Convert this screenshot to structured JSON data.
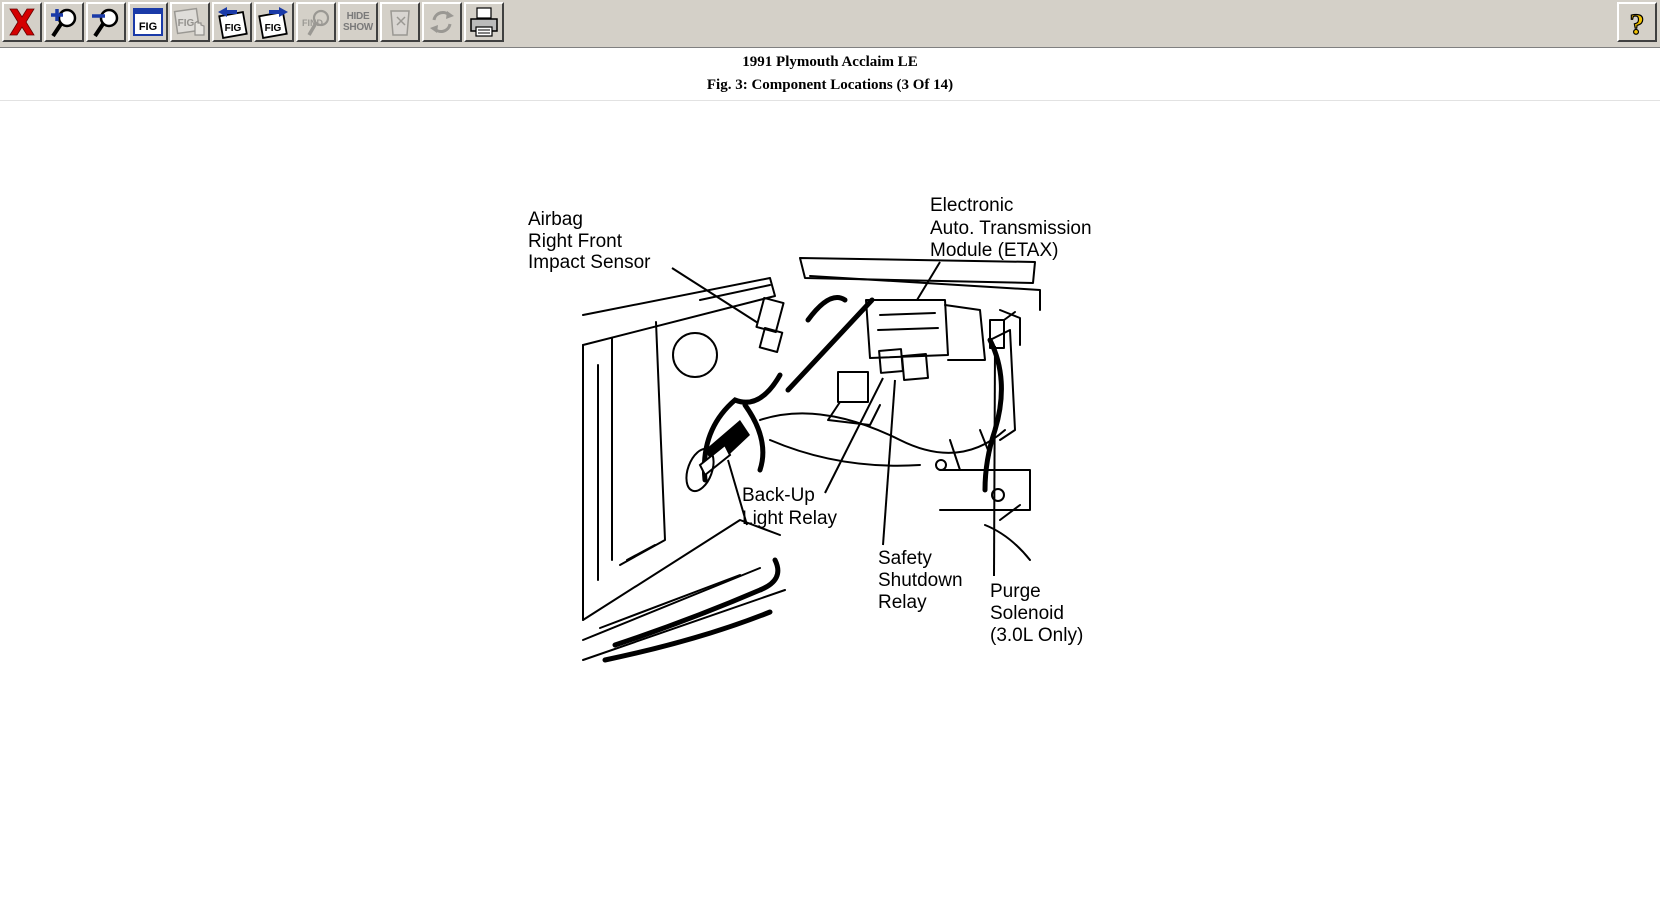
{
  "toolbar": {
    "buttons": [
      {
        "name": "close",
        "icon": "close-x-icon",
        "enabled": true
      },
      {
        "name": "zoom-in",
        "icon": "zoom-in-icon",
        "enabled": true
      },
      {
        "name": "zoom-out",
        "icon": "zoom-out-icon",
        "enabled": true
      },
      {
        "name": "figure-index",
        "icon": "fig-window-icon",
        "enabled": true
      },
      {
        "name": "figure-select",
        "icon": "fig-hand-icon",
        "enabled": false
      },
      {
        "name": "previous-figure",
        "icon": "fig-prev-icon",
        "enabled": true
      },
      {
        "name": "next-figure",
        "icon": "fig-next-icon",
        "enabled": true
      },
      {
        "name": "find",
        "icon": "find-icon",
        "enabled": false
      },
      {
        "name": "hide-show",
        "icon": "hide-show-icon",
        "enabled": false
      },
      {
        "name": "clear",
        "icon": "eraser-icon",
        "enabled": false
      },
      {
        "name": "rotate",
        "icon": "rotate-icon",
        "enabled": false
      },
      {
        "name": "print",
        "icon": "printer-icon",
        "enabled": true
      },
      {
        "name": "help",
        "icon": "help-question-icon",
        "enabled": true
      }
    ],
    "fig_text": "FIG",
    "find_text": "FIND",
    "hide_text": "HIDE",
    "show_text": "SHOW",
    "help_text": "?"
  },
  "header": {
    "title": "1991 Plymouth Acclaim LE",
    "subtitle": "Fig. 3: Component Locations (3 Of 14)"
  },
  "figure": {
    "labels": {
      "airbag_line1": "Airbag",
      "airbag_line2": "Right Front",
      "airbag_line3": "Impact Sensor",
      "etax_line1": "Electronic",
      "etax_line2": "Auto. Transmission",
      "etax_line3": "Module (ETAX)",
      "backup_line1": "Back-Up",
      "backup_line2": "Light Relay",
      "safety_line1": "Safety",
      "safety_line2": "Shutdown",
      "safety_line3": "Relay",
      "purge_line1": "Purge",
      "purge_line2": "Solenoid",
      "purge_line3": "(3.0L Only)"
    }
  },
  "colors": {
    "toolbar_bg": "#d4d0c8",
    "close_red": "#d40000",
    "icon_blue": "#1a3aa8",
    "help_yellow": "#f2c200"
  }
}
